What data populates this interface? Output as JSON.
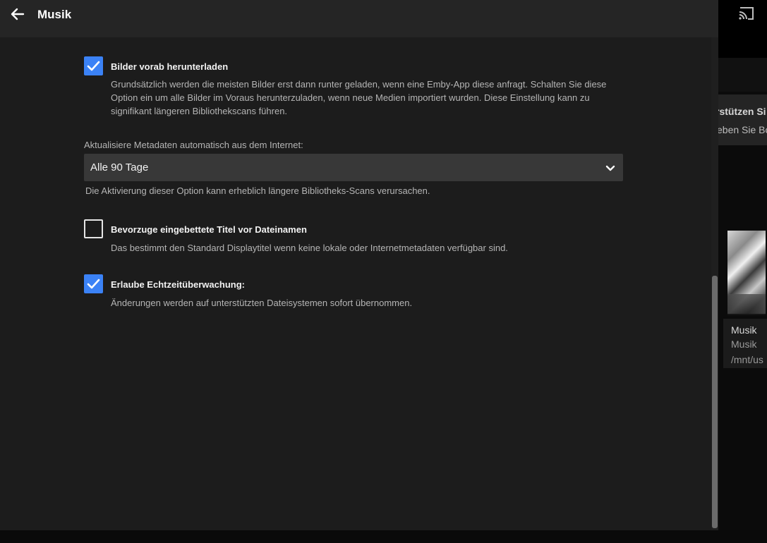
{
  "dialog": {
    "title": "Musik",
    "back_icon": "arrow-left-icon"
  },
  "options": {
    "download_images": {
      "checked": true,
      "label": "Bilder vorab herunterladen",
      "description": "Grundsätzlich werden die meisten Bilder erst dann runter geladen, wenn eine Emby-App diese anfragt. Schalten Sie diese Option ein um alle Bilder im Voraus herunterzuladen, wenn neue Medien importiert wurden. Diese Einstellung kann zu signifikant längeren Bibliothekscans führen."
    },
    "metadata_refresh": {
      "label": "Aktualisiere Metadaten automatisch aus dem Internet:",
      "value": "Alle 90 Tage",
      "description": "Die Aktivierung dieser Option kann erheblich längere Bibliotheks-Scans verursachen."
    },
    "prefer_embedded_titles": {
      "checked": false,
      "label": "Bevorzuge eingebettete Titel vor Dateinamen",
      "description": "Das bestimmt den Standard Displaytitel wenn keine lokale oder Internetmetadaten verfügbar sind."
    },
    "realtime_monitoring": {
      "checked": true,
      "label": "Erlaube Echtzeitüberwachung:",
      "description": "Änderungen werden auf unterstützten Dateisystemen sofort übernommen."
    }
  },
  "background": {
    "cast_icon": "cast-icon",
    "banner_title": "rstützen Si",
    "banner_subtitle": "eben Sie Bo",
    "card": {
      "title": "Musik",
      "type": "Musik",
      "path": "/mnt/us"
    }
  },
  "colors": {
    "accent": "#3b82f6",
    "dialog_bg": "#1c1c1c",
    "header_bg": "#252525"
  }
}
